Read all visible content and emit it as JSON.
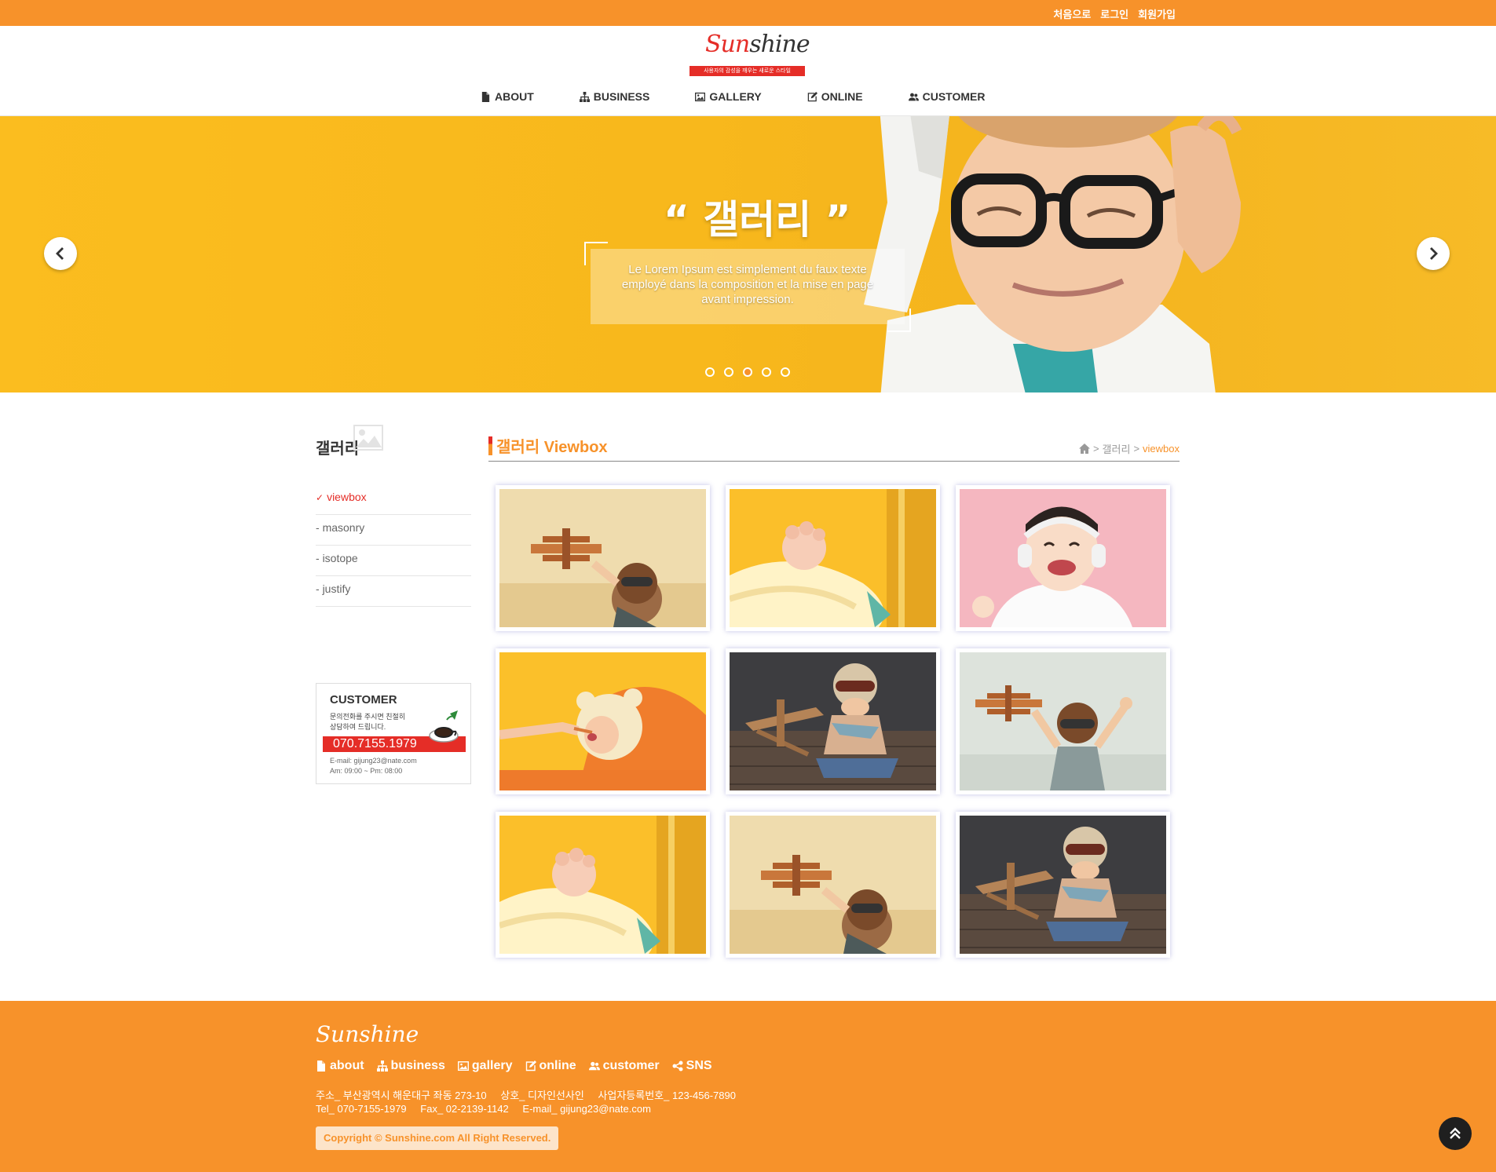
{
  "top_links": [
    "처음으로",
    "로그인",
    "회원가입"
  ],
  "logo": {
    "part1": "Sun",
    "part2": "shine",
    "tagline": "사용자의 감성을 깨우는 새로운 스타일"
  },
  "nav": [
    {
      "label": "ABOUT",
      "icon": "file-icon"
    },
    {
      "label": "BUSINESS",
      "icon": "sitemap-icon"
    },
    {
      "label": "GALLERY",
      "icon": "image-icon"
    },
    {
      "label": "ONLINE",
      "icon": "edit-icon"
    },
    {
      "label": "CUSTOMER",
      "icon": "users-icon"
    }
  ],
  "hero": {
    "title": "“ 갤러리 ”",
    "text": "Le Lorem Ipsum est simplement du faux texte employé dans la composition et la mise en page avant impression.",
    "slide_count": 5,
    "active_slide": 3
  },
  "sidebar": {
    "title": "갤러리",
    "items": [
      {
        "label": "viewbox",
        "prefix": "✓",
        "active": true
      },
      {
        "label": "masonry",
        "prefix": "-"
      },
      {
        "label": "isotope",
        "prefix": "-"
      },
      {
        "label": "justify",
        "prefix": "-"
      }
    ]
  },
  "customer_box": {
    "title": "CUSTOMER",
    "desc_line1": "문의전화를 주시면 친절히",
    "desc_line2": "상담하여 드립니다.",
    "phone": "070.7155.1979",
    "email": "E-mail: gijung23@nate.com",
    "hours": "Am: 09:00 ~ Pm: 08:00"
  },
  "content": {
    "title": "갤러리 Viewbox",
    "breadcrumb": {
      "sep1": ">",
      "section": "갤러리",
      "sep2": ">",
      "current": "viewbox"
    }
  },
  "gallery": [
    "airplane-kid",
    "baby-hand",
    "baby-headphones",
    "baby-feeding",
    "aviator-kid-floor",
    "airplane-kid-arms",
    "baby-hand",
    "airplane-kid",
    "aviator-kid-floor"
  ],
  "footer": {
    "logo": "Sunshine",
    "nav": [
      {
        "label": "about",
        "icon": "file-icon"
      },
      {
        "label": "business",
        "icon": "sitemap-icon"
      },
      {
        "label": "gallery",
        "icon": "image-icon"
      },
      {
        "label": "online",
        "icon": "edit-icon"
      },
      {
        "label": "customer",
        "icon": "users-icon"
      },
      {
        "label": "SNS",
        "icon": "share-icon"
      }
    ],
    "address": "주소_ 부산광역시 해운대구 좌동 273-10",
    "company": "상호_ 디자인선사인",
    "biz_no": "사업자등록번호_ 123-456-7890",
    "tel": "Tel_ 070-7155-1979",
    "fax": "Fax_ 02-2139-1142",
    "email": "E-mail_ gijung23@nate.com",
    "copyright": "Copyright © Sunshine.com All Right Reserved."
  },
  "colors": {
    "accent": "#f7922a",
    "brand_red": "#e52d27",
    "hero_bg": "#fbbd1f"
  }
}
